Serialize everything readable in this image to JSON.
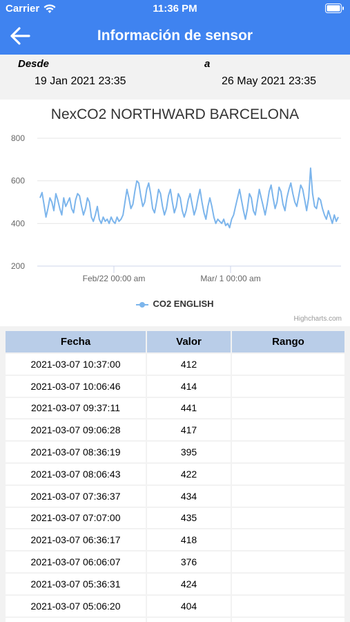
{
  "status_bar": {
    "carrier": "Carrier",
    "time": "11:36 PM"
  },
  "nav": {
    "title": "Información de sensor",
    "back_icon": "arrow-left-icon"
  },
  "range": {
    "from_label": "Desde",
    "to_label": "a",
    "from_value": "19 Jan 2021 23:35",
    "to_value": "26 May 2021 23:35"
  },
  "chart_data": {
    "type": "line",
    "title": "NexCO2 NORTHWARD BARCELONA",
    "y_ticks": [
      "800",
      "600",
      "400",
      "200"
    ],
    "ylim": [
      200,
      800
    ],
    "x_ticks": [
      "Feb/22 00:00 am",
      "Mar/ 1 00:00 am"
    ],
    "series": [
      {
        "name": "CO2 ENGLISH",
        "color": "#7cb5ec",
        "values": [
          520,
          545,
          490,
          430,
          470,
          520,
          500,
          460,
          540,
          510,
          470,
          440,
          520,
          480,
          500,
          520,
          470,
          450,
          510,
          540,
          530,
          480,
          440,
          470,
          520,
          500,
          430,
          410,
          440,
          480,
          420,
          400,
          430,
          410,
          420,
          400,
          430,
          410,
          400,
          430,
          410,
          420,
          440,
          500,
          560,
          520,
          470,
          490,
          550,
          600,
          590,
          530,
          480,
          500,
          560,
          590,
          540,
          470,
          450,
          500,
          560,
          540,
          480,
          440,
          470,
          530,
          560,
          500,
          450,
          480,
          540,
          520,
          460,
          430,
          460,
          510,
          540,
          490,
          440,
          470,
          520,
          560,
          500,
          450,
          420,
          480,
          520,
          480,
          430,
          400,
          420,
          410,
          400,
          420,
          390,
          400,
          380,
          420,
          440,
          480,
          520,
          560,
          510,
          460,
          420,
          470,
          540,
          520,
          460,
          440,
          500,
          560,
          520,
          480,
          440,
          490,
          550,
          580,
          520,
          470,
          500,
          570,
          550,
          490,
          460,
          520,
          560,
          590,
          540,
          500,
          480,
          530,
          580,
          560,
          510,
          460,
          520,
          660,
          540,
          480,
          470,
          520,
          510,
          470,
          440,
          420,
          460,
          430,
          400,
          440,
          410,
          430
        ]
      }
    ],
    "credits": "Highcharts.com"
  },
  "table": {
    "headers": [
      "Fecha",
      "Valor",
      "Rango"
    ],
    "rows": [
      [
        "2021-03-07 10:37:00",
        "412",
        ""
      ],
      [
        "2021-03-07 10:06:46",
        "414",
        ""
      ],
      [
        "2021-03-07 09:37:11",
        "441",
        ""
      ],
      [
        "2021-03-07 09:06:28",
        "417",
        ""
      ],
      [
        "2021-03-07 08:36:19",
        "395",
        ""
      ],
      [
        "2021-03-07 08:06:43",
        "422",
        ""
      ],
      [
        "2021-03-07 07:36:37",
        "434",
        ""
      ],
      [
        "2021-03-07 07:07:00",
        "435",
        ""
      ],
      [
        "2021-03-07 06:36:17",
        "418",
        ""
      ],
      [
        "2021-03-07 06:06:07",
        "376",
        ""
      ],
      [
        "2021-03-07 05:36:31",
        "424",
        ""
      ],
      [
        "2021-03-07 05:06:20",
        "404",
        ""
      ],
      [
        "",
        "",
        ""
      ]
    ]
  }
}
